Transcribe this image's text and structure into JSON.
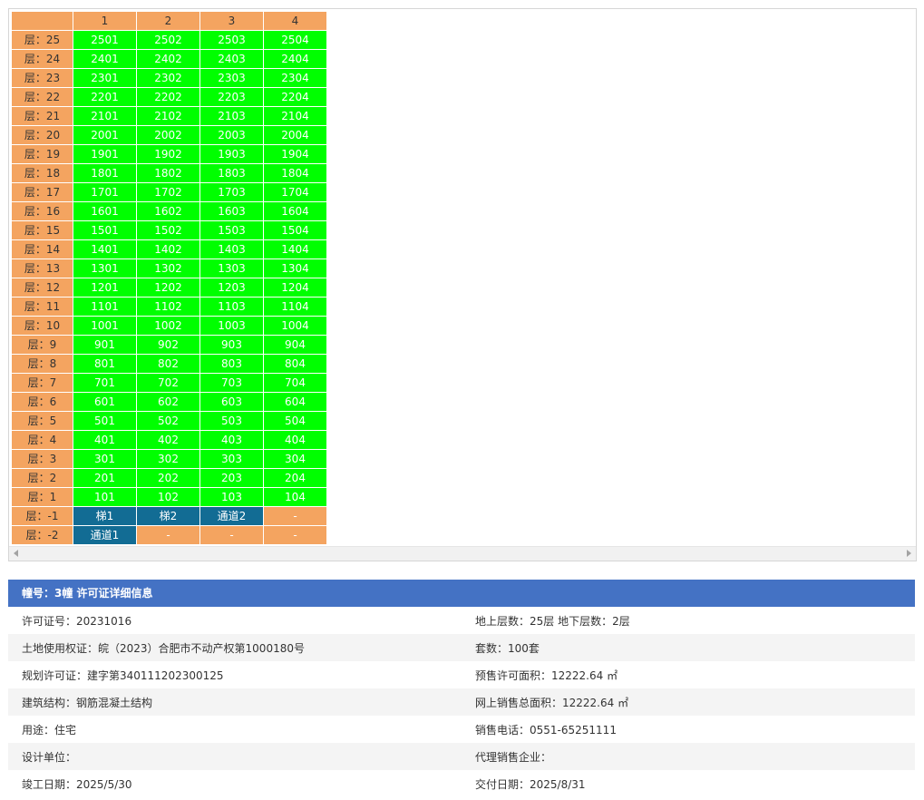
{
  "grid": {
    "columns": [
      "",
      "1",
      "2",
      "3",
      "4"
    ],
    "rows": [
      {
        "floor": "层：25",
        "units": [
          "2501",
          "2502",
          "2503",
          "2504"
        ]
      },
      {
        "floor": "层：24",
        "units": [
          "2401",
          "2402",
          "2403",
          "2404"
        ]
      },
      {
        "floor": "层：23",
        "units": [
          "2301",
          "2302",
          "2303",
          "2304"
        ]
      },
      {
        "floor": "层：22",
        "units": [
          "2201",
          "2202",
          "2203",
          "2204"
        ]
      },
      {
        "floor": "层：21",
        "units": [
          "2101",
          "2102",
          "2103",
          "2104"
        ]
      },
      {
        "floor": "层：20",
        "units": [
          "2001",
          "2002",
          "2003",
          "2004"
        ]
      },
      {
        "floor": "层：19",
        "units": [
          "1901",
          "1902",
          "1903",
          "1904"
        ]
      },
      {
        "floor": "层：18",
        "units": [
          "1801",
          "1802",
          "1803",
          "1804"
        ]
      },
      {
        "floor": "层：17",
        "units": [
          "1701",
          "1702",
          "1703",
          "1704"
        ]
      },
      {
        "floor": "层：16",
        "units": [
          "1601",
          "1602",
          "1603",
          "1604"
        ]
      },
      {
        "floor": "层：15",
        "units": [
          "1501",
          "1502",
          "1503",
          "1504"
        ]
      },
      {
        "floor": "层：14",
        "units": [
          "1401",
          "1402",
          "1403",
          "1404"
        ]
      },
      {
        "floor": "层：13",
        "units": [
          "1301",
          "1302",
          "1303",
          "1304"
        ]
      },
      {
        "floor": "层：12",
        "units": [
          "1201",
          "1202",
          "1203",
          "1204"
        ]
      },
      {
        "floor": "层：11",
        "units": [
          "1101",
          "1102",
          "1103",
          "1104"
        ]
      },
      {
        "floor": "层：10",
        "units": [
          "1001",
          "1002",
          "1003",
          "1004"
        ]
      },
      {
        "floor": "层：9",
        "units": [
          "901",
          "902",
          "903",
          "904"
        ]
      },
      {
        "floor": "层：8",
        "units": [
          "801",
          "802",
          "803",
          "804"
        ]
      },
      {
        "floor": "层：7",
        "units": [
          "701",
          "702",
          "703",
          "704"
        ]
      },
      {
        "floor": "层：6",
        "units": [
          "601",
          "602",
          "603",
          "604"
        ]
      },
      {
        "floor": "层：5",
        "units": [
          "501",
          "502",
          "503",
          "504"
        ]
      },
      {
        "floor": "层：4",
        "units": [
          "401",
          "402",
          "403",
          "404"
        ]
      },
      {
        "floor": "层：3",
        "units": [
          "301",
          "302",
          "303",
          "304"
        ]
      },
      {
        "floor": "层：2",
        "units": [
          "201",
          "202",
          "203",
          "204"
        ]
      },
      {
        "floor": "层：1",
        "units": [
          "101",
          "102",
          "103",
          "104"
        ]
      },
      {
        "floor": "层：-1",
        "units": [
          "梯1",
          "梯2",
          "通道2",
          "-"
        ],
        "types": [
          "special",
          "special",
          "special",
          "empty"
        ]
      },
      {
        "floor": "层：-2",
        "units": [
          "通道1",
          "-",
          "-",
          "-"
        ],
        "types": [
          "special",
          "empty",
          "empty",
          "empty"
        ]
      }
    ]
  },
  "colors": {
    "available": "#00ff00",
    "header": "#f4a460",
    "special": "#126c94",
    "panel_header": "#4472c4"
  },
  "info": {
    "title": "幢号：3幢 许可证详细信息",
    "rows": [
      [
        "许可证号：20231016",
        "地上层数：25层  地下层数：2层"
      ],
      [
        "土地使用权证：皖（2023）合肥市不动产权第1000180号",
        "套数：100套"
      ],
      [
        "规划许可证：建字第340111202300125",
        "预售许可面积：12222.64 ㎡"
      ],
      [
        "建筑结构：钢筋混凝土结构",
        "网上销售总面积：12222.64 ㎡"
      ],
      [
        "用途：住宅",
        "销售电话：0551-65251111"
      ],
      [
        "设计单位：",
        "代理销售企业："
      ],
      [
        "竣工日期：2025/5/30",
        "交付日期：2025/8/31"
      ]
    ]
  }
}
